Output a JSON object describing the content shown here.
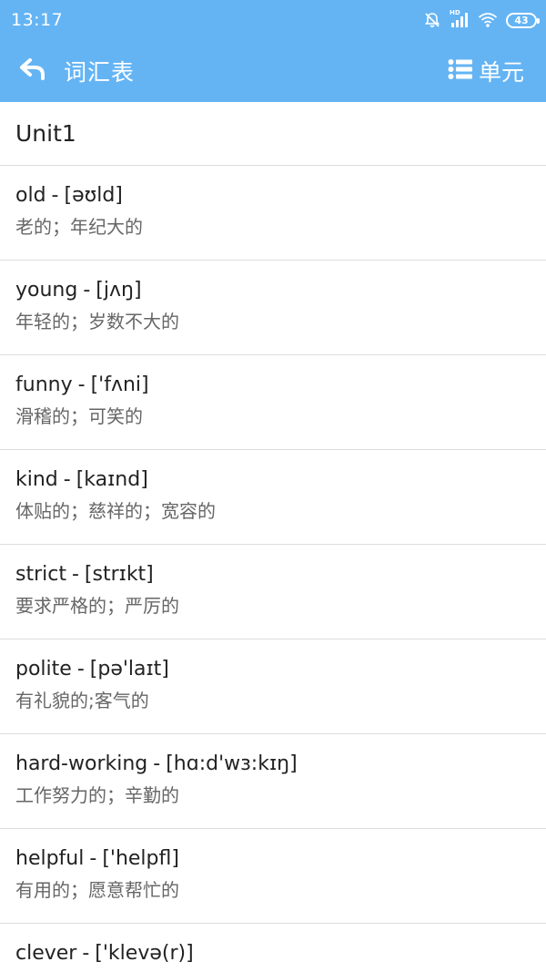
{
  "status_bar": {
    "time": "13:17",
    "network_label": "HD",
    "battery": "43"
  },
  "app_bar": {
    "title": "词汇表",
    "unit_button_label": "单元"
  },
  "unit": {
    "title": "Unit1"
  },
  "words": [
    {
      "word": "old",
      "separator": "-",
      "phonetic": "[əʊld]",
      "meaning": "老的；年纪大的"
    },
    {
      "word": "young",
      "separator": "-",
      "phonetic": "[jʌŋ]",
      "meaning": "年轻的；岁数不大的"
    },
    {
      "word": "funny",
      "separator": "-",
      "phonetic": "['fʌni]",
      "meaning": "滑稽的；可笑的"
    },
    {
      "word": "kind",
      "separator": "-",
      "phonetic": "[kaɪnd]",
      "meaning": "体贴的；慈祥的；宽容的"
    },
    {
      "word": "strict",
      "separator": "-",
      "phonetic": "[strɪkt]",
      "meaning": "要求严格的；严厉的"
    },
    {
      "word": "polite",
      "separator": "-",
      "phonetic": "[pə'laɪt]",
      "meaning": "有礼貌的;客气的"
    },
    {
      "word": "hard-working",
      "separator": "-",
      "phonetic": "[hɑ:d'wɜ:kɪŋ]",
      "meaning": "工作努力的；辛勤的"
    },
    {
      "word": "helpful",
      "separator": "-",
      "phonetic": "['helpfl]",
      "meaning": "有用的；愿意帮忙的"
    },
    {
      "word": "clever",
      "separator": "-",
      "phonetic": "['klevə(r)]",
      "meaning": ""
    }
  ],
  "colors": {
    "primary": "#64b4f4",
    "divider": "#dddddd",
    "text_primary": "#222222",
    "text_secondary": "#666666"
  },
  "icons": {
    "back": "back-arrow-icon",
    "menu": "list-icon",
    "mute": "bell-off-icon",
    "signal": "signal-icon",
    "wifi": "wifi-icon",
    "battery": "battery-icon"
  }
}
